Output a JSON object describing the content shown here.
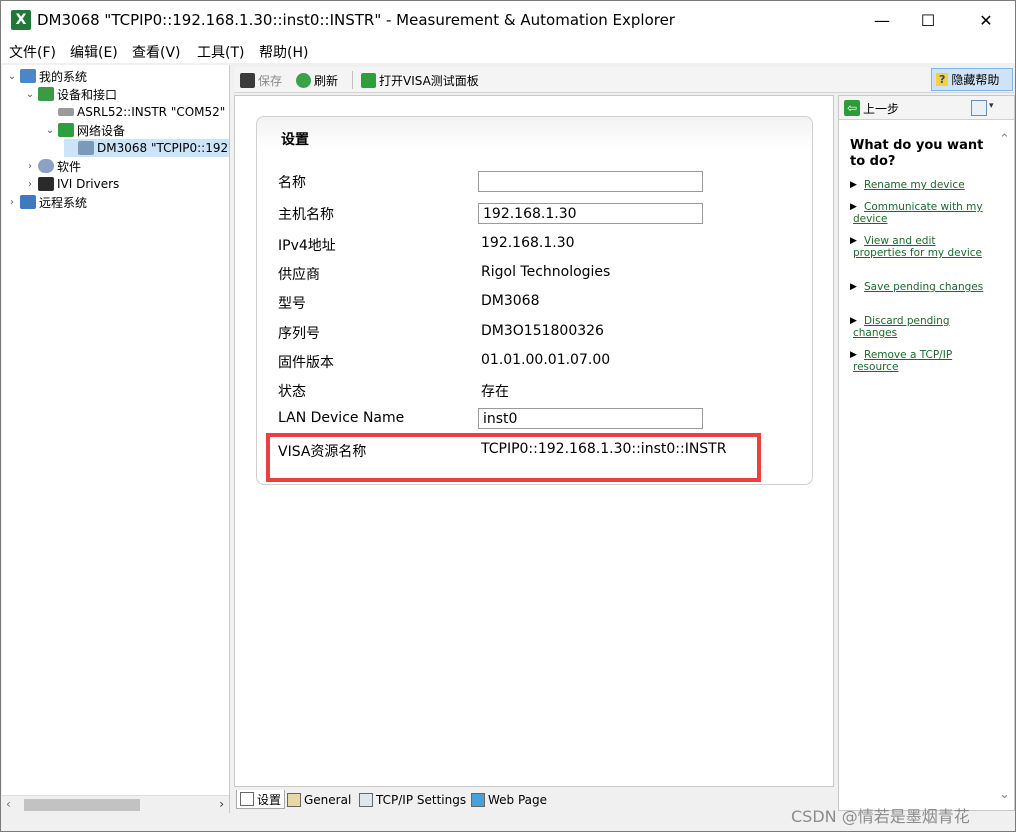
{
  "window": {
    "app_icon": "X",
    "title": "DM3068 \"TCPIP0::192.168.1.30::inst0::INSTR\" - Measurement & Automation Explorer",
    "controls": {
      "minimize": "—",
      "maximize": "☐",
      "close": "✕"
    }
  },
  "menu": [
    "文件(F)",
    "编辑(E)",
    "查看(V)",
    "工具(T)",
    "帮助(H)"
  ],
  "tree": {
    "items": [
      {
        "label": "我的系统",
        "arrow": "⌄",
        "icon": "computer-icon"
      },
      {
        "label": "设备和接口",
        "arrow": "⌄",
        "icon": "devices-icon"
      },
      {
        "label": "ASRL52::INSTR \"COM52\"",
        "arrow": "",
        "icon": "serial-port-icon"
      },
      {
        "label": "网络设备",
        "arrow": "⌄",
        "icon": "network-icon"
      },
      {
        "label": "DM3068 \"TCPIP0::192",
        "arrow": "",
        "icon": "network-device-icon"
      },
      {
        "label": "软件",
        "arrow": "›",
        "icon": "software-icon"
      },
      {
        "label": "IVI Drivers",
        "arrow": "›",
        "icon": "ivi-icon"
      },
      {
        "label": "远程系统",
        "arrow": "›",
        "icon": "remote-systems-icon"
      }
    ],
    "scroll_left": "‹",
    "scroll_right": "›"
  },
  "toolbar": {
    "save": "保存",
    "refresh": "刷新",
    "open_visa_panel": "打开VISA测试面板",
    "hide_help": "隐藏帮助",
    "hide_help_icon": "?"
  },
  "settings": {
    "title": "设置",
    "name_label": "名称",
    "name_value": "",
    "hostname_label": "主机名称",
    "hostname_value": "192.168.1.30",
    "ipv4_label": "IPv4地址",
    "ipv4_value": "192.168.1.30",
    "vendor_label": "供应商",
    "vendor_value": "Rigol Technologies",
    "model_label": "型号",
    "model_value": "DM3068",
    "serial_label": "序列号",
    "serial_value": "DM3O151800326",
    "firmware_label": "固件版本",
    "firmware_value": "01.01.00.01.07.00",
    "status_label": "状态",
    "status_value": "存在",
    "lan_name_label": "LAN Device Name",
    "lan_name_value": "inst0",
    "visa_label": "VISA资源名称",
    "visa_value": "TCPIP0::192.168.1.30::inst0::INSTR",
    "highlight_color": "#ec3f3f"
  },
  "tabs": [
    "设置",
    "General",
    "TCP/IP Settings",
    "Web Page"
  ],
  "help": {
    "back": "上一步",
    "back_icon": "⇦",
    "options_arrow": "▾",
    "heading": "What do you want to do?",
    "links": [
      "Rename my device",
      "Communicate with my device",
      "View and edit properties for my device",
      "Save pending changes",
      "Discard pending changes",
      "Remove a TCP/IP resource"
    ],
    "bullet": "▶",
    "scroll_up": "⌃",
    "scroll_down": "⌄",
    "link_color": "#1a6a2a"
  },
  "watermark": "CSDN @情若是墨烟青花"
}
